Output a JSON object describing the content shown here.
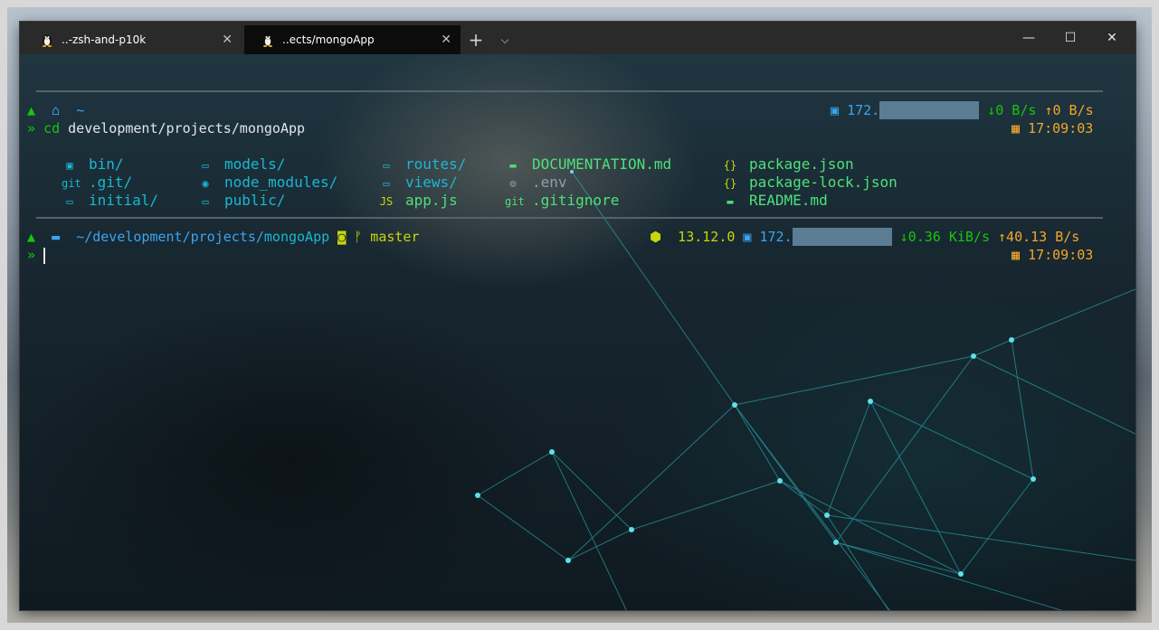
{
  "tabs": [
    {
      "label": "..-zsh-and-p10k",
      "close": "✕"
    },
    {
      "label": "..ects/mongoApp",
      "close": "✕"
    }
  ],
  "titlebar": {
    "new_tab": "+",
    "dropdown": "⌵",
    "minimize": "—",
    "maximize": "☐",
    "close": "✕"
  },
  "prompt1": {
    "home_icon": "⌂",
    "dir": "~",
    "arrow": "»",
    "cmd": "cd",
    "arg": "development/projects/mongoApp",
    "ip_prefix": "172.",
    "down": "↓0 B/s",
    "up": "↑0 B/s",
    "time": "17:09:03"
  },
  "listing": {
    "col1": [
      "bin/",
      ".git/",
      "initial/"
    ],
    "col2": [
      "models/",
      "node_modules/",
      "public/"
    ],
    "col3": [
      "routes/",
      "views/",
      "app.js"
    ],
    "col4": [
      "DOCUMENTATION.md",
      ".env",
      ".gitignore"
    ],
    "col5": [
      "package.json",
      "package-lock.json",
      "README.md"
    ]
  },
  "prompt2": {
    "path_prefix": "~/development/projects/",
    "path_last": "mongoApp",
    "branch_icon": "ᚠ",
    "branch": "master",
    "node_version": "13.12.0",
    "ip_prefix": "172.",
    "down": "↓0.36 KiB/s",
    "up": "↑40.13 B/s",
    "time": "17:09:03",
    "arrow": "»"
  },
  "colors": {
    "prompt_green": "#16c60c",
    "dir_blue": "#3aa4f0",
    "time_orange": "#f4a62a"
  },
  "icons": [
    "linux-tux-icon",
    "folder-icon",
    "git-icon",
    "node-icon",
    "js-icon",
    "markdown-icon",
    "json-icon",
    "env-icon",
    "clock-icon",
    "network-icon"
  ]
}
